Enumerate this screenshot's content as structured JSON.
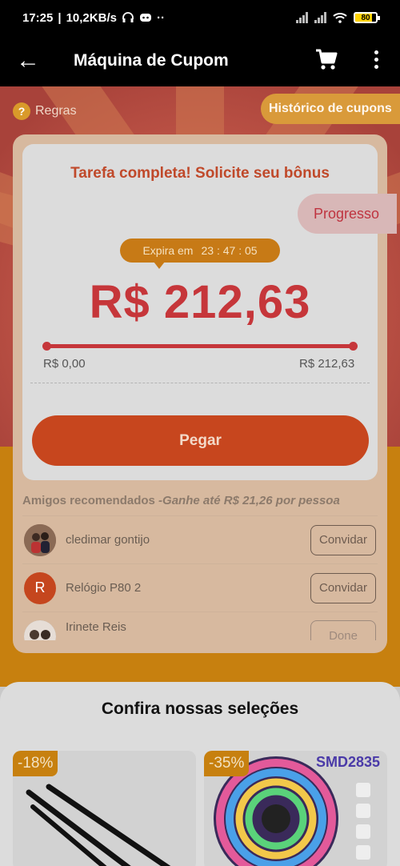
{
  "status": {
    "time": "17:25",
    "speed": "10,2KB/s",
    "battery": "80",
    "dots": "··"
  },
  "appbar": {
    "back_glyph": "←",
    "title": "Máquina de Cupom"
  },
  "hero": {
    "rules": "Regras",
    "rules_icon": "?",
    "history": "Histórico de cupons"
  },
  "card": {
    "task": "Tarefa completa! Solicite seu bônus",
    "progress": "Progresso",
    "expires_label": "Expira em",
    "expires_time": "23 : 47 : 05",
    "amount": "R$ 212,63",
    "bar_fill_fraction": 1.0,
    "min": "R$ 0,00",
    "max": "R$ 212,63",
    "button": "Pegar"
  },
  "friends": {
    "title": "Amigos recomendados",
    "subtitle": "-Ganhe até R$ 21,26 por pessoa",
    "items": [
      {
        "name": "cledimar gontijo",
        "action": "Convidar",
        "initial": ""
      },
      {
        "name": "Relógio P80 2",
        "action": "Convidar",
        "initial": "R"
      },
      {
        "name": "Irinete Reis",
        "action": "Done",
        "initial": ""
      }
    ]
  },
  "selections": {
    "title": "Confira nossas seleções",
    "products": [
      {
        "discount": "-18%"
      },
      {
        "discount": "-35%",
        "brand_text": "SMD2835"
      }
    ]
  }
}
